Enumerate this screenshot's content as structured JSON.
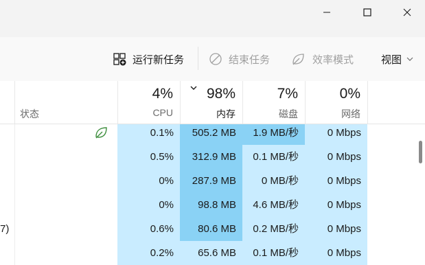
{
  "toolbar": {
    "run_new_task": "运行新任务",
    "end_task": "结束任务",
    "efficiency_mode": "效率模式",
    "view": "视图"
  },
  "header": {
    "status_label": "状态",
    "cpu": {
      "percent": "4%",
      "label": "CPU"
    },
    "memory": {
      "percent": "98%",
      "label": "内存"
    },
    "disk": {
      "percent": "7%",
      "label": "磁盘"
    },
    "network": {
      "percent": "0%",
      "label": "网络"
    }
  },
  "rows": [
    {
      "cpu": "0.1%",
      "memory": "505.2 MB",
      "disk": "1.9 MB/秒",
      "network": "0 Mbps",
      "status_icon": "leaf-icon"
    },
    {
      "cpu": "0.5%",
      "memory": "312.9 MB",
      "disk": "0.1 MB/秒",
      "network": "0 Mbps"
    },
    {
      "cpu": "0%",
      "memory": "287.9 MB",
      "disk": "0 MB/秒",
      "network": "0 Mbps"
    },
    {
      "cpu": "0%",
      "memory": "98.8 MB",
      "disk": "4.6 MB/秒",
      "network": "0 Mbps"
    },
    {
      "cpu": "0.6%",
      "memory": "80.6 MB",
      "disk": "0.2 MB/秒",
      "network": "0 Mbps",
      "name_fragment": "7)"
    },
    {
      "cpu": "0.2%",
      "memory": "65.6 MB",
      "disk": "0.1 MB/秒",
      "network": "0 Mbps"
    }
  ],
  "colors": {
    "heat_light": "#c9ecff",
    "heat_mid": "#a8e0fb",
    "heat_strong": "#8ad2f5"
  }
}
